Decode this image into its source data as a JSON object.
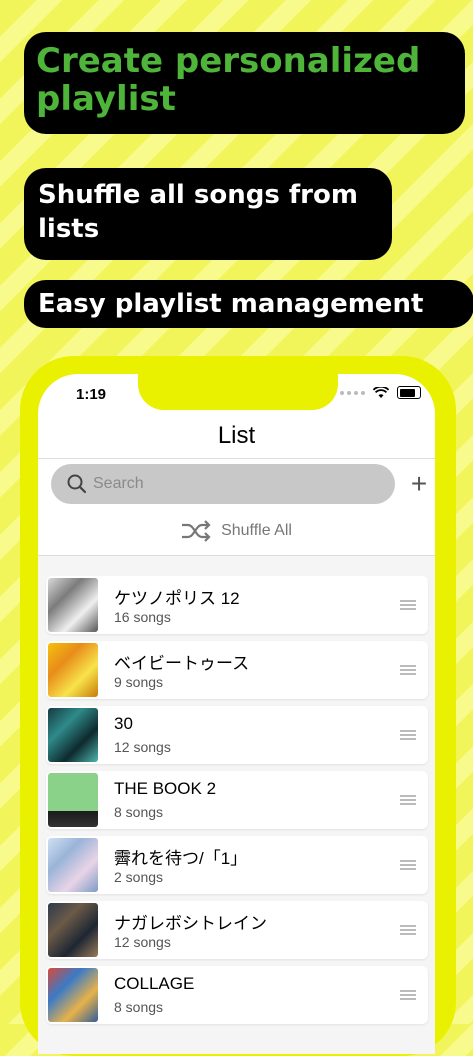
{
  "headlines": {
    "h1": "Create personalized playlist",
    "h2": "Shuffle all songs from lists",
    "h3": "Easy playlist management"
  },
  "status": {
    "time": "1:19"
  },
  "nav": {
    "title": "List"
  },
  "search": {
    "placeholder": "Search"
  },
  "shuffle": {
    "label": "Shuffle All"
  },
  "playlists": [
    {
      "title": "ケツノポリス 12",
      "count": "16 songs"
    },
    {
      "title": "ベイビートゥース",
      "count": "9 songs"
    },
    {
      "title": "30",
      "count": "12 songs"
    },
    {
      "title": "THE BOOK 2",
      "count": "8 songs"
    },
    {
      "title": "霽れを待つ/「1」",
      "count": "2 songs"
    },
    {
      "title": "ナガレボシトレイン",
      "count": "12 songs"
    },
    {
      "title": "COLLAGE",
      "count": "8 songs"
    }
  ],
  "colors": {
    "background": "#f2f55a",
    "headline_green": "#4fb43a",
    "phone_frame": "#e9f000"
  }
}
